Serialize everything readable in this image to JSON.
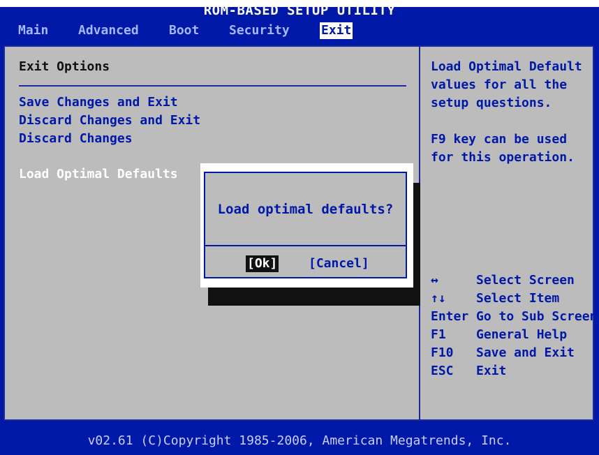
{
  "title": "ROM-BASED SETUP UTILITY",
  "menu": [
    {
      "label": "Main",
      "active": false
    },
    {
      "label": "Advanced",
      "active": false
    },
    {
      "label": "Boot",
      "active": false
    },
    {
      "label": "Security",
      "active": false
    },
    {
      "label": "Exit",
      "active": true
    }
  ],
  "main": {
    "heading": "Exit Options",
    "options": [
      "Save Changes and Exit",
      "Discard Changes and Exit",
      "Discard Changes",
      "Load Optimal Defaults"
    ],
    "selected_option": "Load Optimal Defaults"
  },
  "help": {
    "description": "Load Optimal Default\nvalues for all the\nsetup questions.",
    "note": "F9 key can be used\nfor this operation.",
    "keys": [
      {
        "key": "↔",
        "desc": "Select Screen"
      },
      {
        "key": "↑↓",
        "desc": "Select Item"
      },
      {
        "key": "Enter",
        "desc": "Go to Sub Screen"
      },
      {
        "key": "F1",
        "desc": "General Help"
      },
      {
        "key": "F10",
        "desc": "Save and Exit"
      },
      {
        "key": "ESC",
        "desc": "Exit"
      }
    ]
  },
  "dialog": {
    "question": "Load optimal defaults?",
    "ok_label": "[Ok]",
    "cancel_label": "[Cancel]"
  },
  "footer": "v02.61 (C)Copyright 1985-2006, American Megatrends, Inc.",
  "colors": {
    "background": "#0018a8",
    "panel": "#bcbcbc",
    "selected": "#ffffff",
    "text": "#0018a8"
  }
}
